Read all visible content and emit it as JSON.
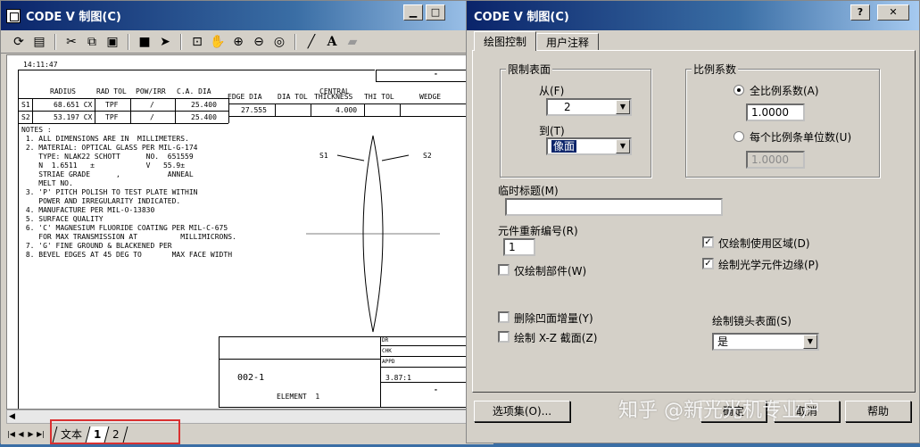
{
  "back_window": {
    "title": "CODE V 制图(C)",
    "doc": {
      "time": "14:11:47",
      "headers": [
        "RADIUS",
        "RAD TOL",
        "POW/IRR",
        "C.A. DIA",
        "EDGE DIA",
        "DIA TOL",
        "CENTRAL",
        "THICKNESS",
        "THI TOL",
        "WEDGE"
      ],
      "rows": [
        {
          "surf": "S1",
          "radius": "68.651 CX",
          "tol": "TPF",
          "pow": "/",
          "ca": "25.400"
        },
        {
          "surf": "S2",
          "radius": "53.197 CX",
          "tol": "TPF",
          "pow": "/",
          "ca": "25.400"
        }
      ],
      "edge_dia": "27.555",
      "thickness": "4.000",
      "notes": [
        "NOTES :",
        " 1. ALL DIMENSIONS ARE IN  MILLIMETERS.",
        " 2. MATERIAL: OPTICAL GLASS PER MIL-G-174",
        "    TYPE: NLAK22 SCHOTT      NO.  651559",
        "    N  1.6511   ±            V   55.9±",
        "    STRIAE GRADE      ,           ANNEAL",
        "    MELT NO.",
        " 3. 'P' PITCH POLISH TO TEST PLATE WITHIN",
        "    POWER AND IRREGULARITY INDICATED.",
        " 4. MANUFACTURE PER MIL-O-13830",
        " 5. SURFACE QUALITY",
        " 6. 'C' MAGNESIUM FLUORIDE COATING PER MIL-C-675",
        "    FOR MAX TRANSMISSION AT          MILLIMICRONS.",
        " 7. 'G' FINE GROUND & BLACKENED PER",
        " 8. BEVEL EDGES AT 45 DEG TO       MAX FACE WIDTH"
      ],
      "s1_label": "S1",
      "s2_label": "S2",
      "part_no": "002-1",
      "element_label": "ELEMENT  1",
      "title_block": [
        "DR",
        "CHK",
        "APPD"
      ],
      "scale": "3.87:1"
    },
    "sheet_tabs": [
      "文本",
      "1",
      "2"
    ],
    "active_sheet": "1"
  },
  "dialog": {
    "title": "CODE V 制图(C)",
    "tabs": [
      "绘图控制",
      "用户注释"
    ],
    "limit_surface": {
      "title": "限制表面",
      "from_label": "从(F)",
      "from_value": "2",
      "to_label": "到(T)",
      "to_value": "像面"
    },
    "scale_factor": {
      "title": "比例系数",
      "full_label": "全比例系数(A)",
      "full_value": "1.0000",
      "per_unit_label": "每个比例条单位数(U)",
      "per_unit_value": "1.0000"
    },
    "temp_title_label": "临时标题(M)",
    "temp_title_value": "",
    "renumber_label": "元件重新编号(R)",
    "renumber_value": "1",
    "only_used_area": {
      "label": "仅绘制使用区域(D)",
      "checked": true
    },
    "only_draw_parts": {
      "label": "仅绘制部件(W)",
      "checked": false
    },
    "draw_edges": {
      "label": "绘制光学元件边缘(P)",
      "checked": true
    },
    "remove_concave": {
      "label": "删除凹面增量(Y)",
      "checked": false
    },
    "draw_xz": {
      "label": "绘制 X-Z 截面(Z)",
      "checked": false
    },
    "lens_surface_label": "绘制镜头表面(S)",
    "lens_surface_value": "是",
    "buttons": {
      "options": "选项集(O)...",
      "ok": "确定",
      "cancel": "取消",
      "help": "帮助"
    }
  },
  "watermark": "知乎 @新光光机专业户"
}
